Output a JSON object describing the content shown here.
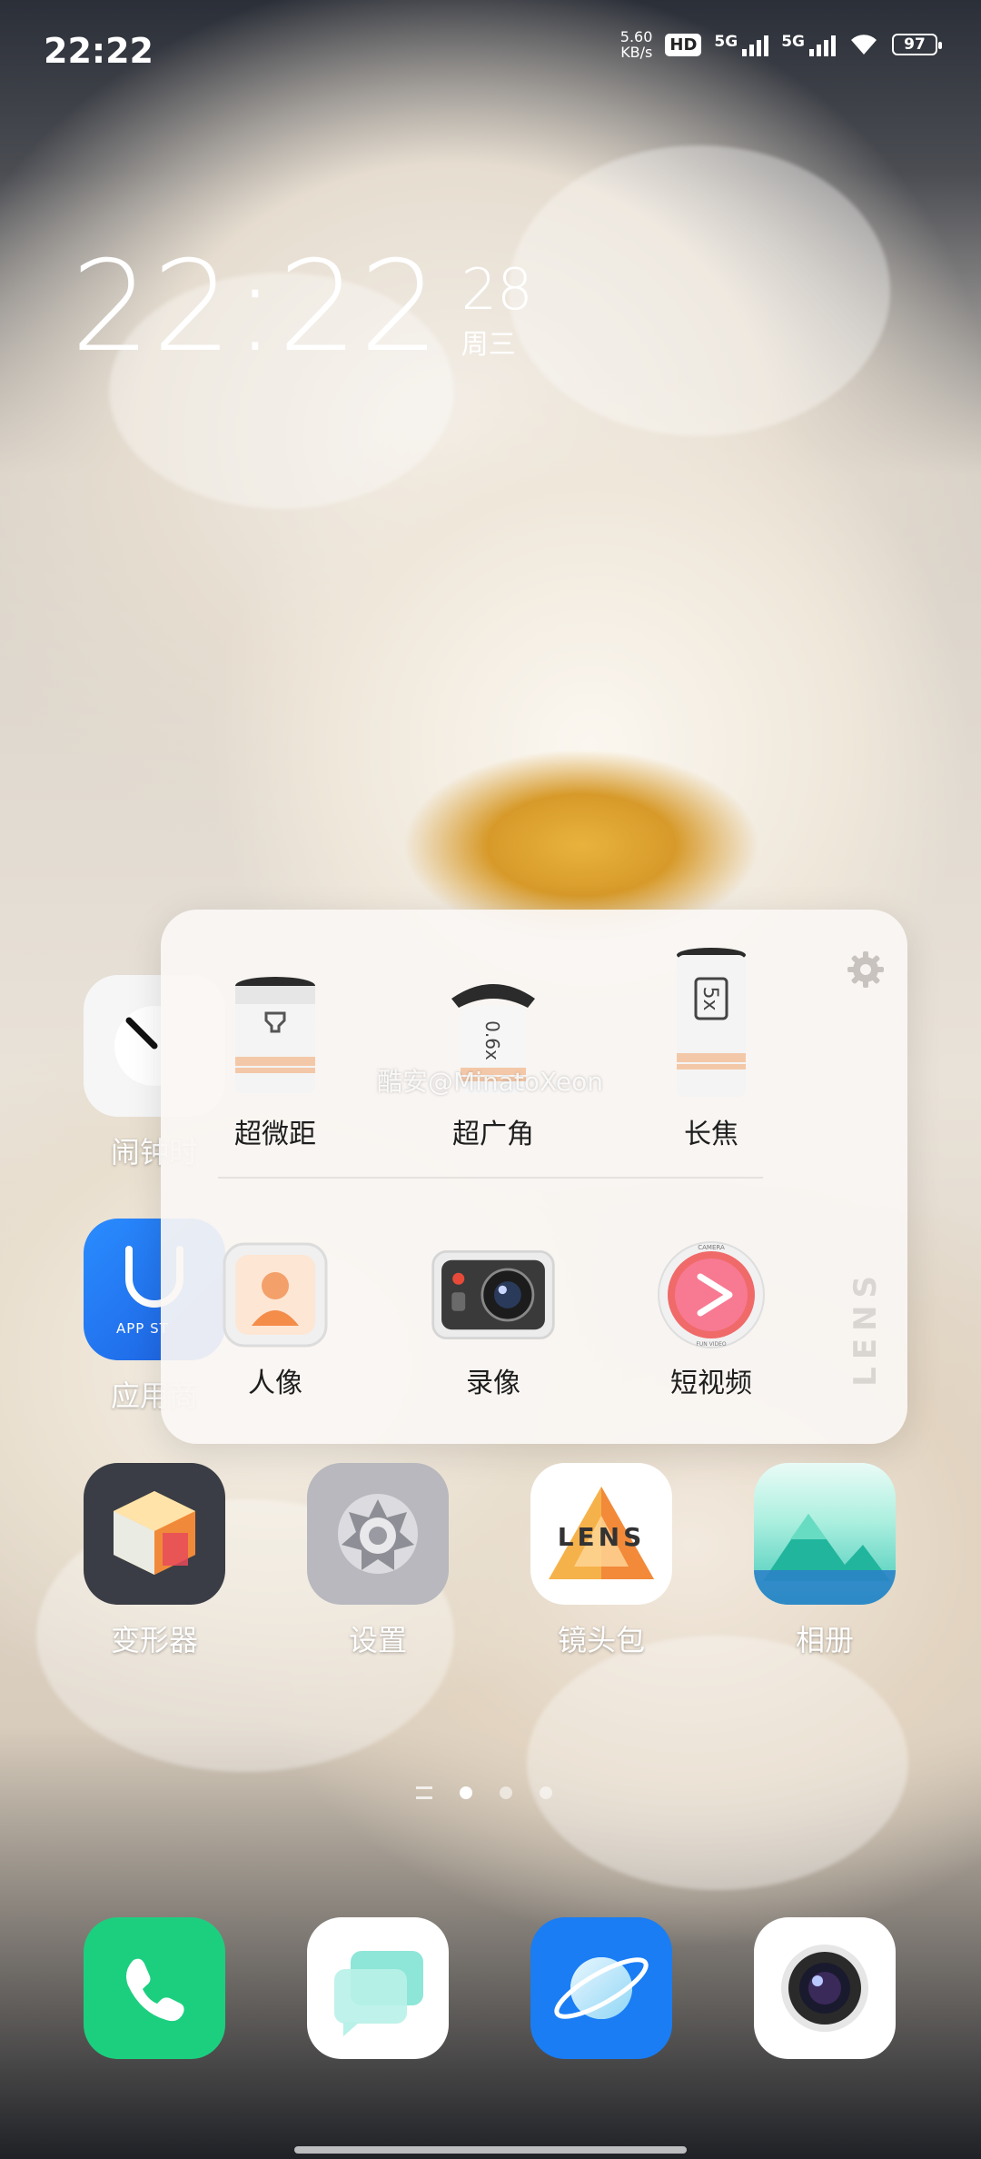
{
  "status_bar": {
    "time": "22:22",
    "net_speed_value": "5.60",
    "net_speed_unit": "KB/s",
    "hd_label": "HD",
    "sim1_label": "5G",
    "sim2_label": "5G",
    "battery": "97"
  },
  "clock_widget": {
    "time": "22:22",
    "day": "28",
    "weekday": "周三"
  },
  "home_apps": {
    "clock_label": "闹钟时",
    "appstore_label": "应用商",
    "appstore_badge": "APP ST"
  },
  "popup": {
    "watermark": "酷安@MinatoXeon",
    "lens_vertical": "LENS",
    "lenses": [
      {
        "label": "超微距",
        "icon": "macro-lens-icon"
      },
      {
        "label": "超广角",
        "icon": "wide-angle-lens-icon",
        "mark": "0.6x"
      },
      {
        "label": "长焦",
        "icon": "telephoto-lens-icon",
        "mark": "5x"
      }
    ],
    "modes": [
      {
        "label": "人像",
        "icon": "portrait-icon"
      },
      {
        "label": "录像",
        "icon": "video-recorder-icon"
      },
      {
        "label": "短视频",
        "icon": "short-video-icon",
        "ring_top": "CAMERA",
        "ring_bottom": "FUN VIDEO"
      }
    ]
  },
  "apps": [
    {
      "label": "变形器"
    },
    {
      "label": "设置"
    },
    {
      "label": "镜头包",
      "logo_text": "LENS"
    },
    {
      "label": "相册"
    }
  ],
  "dock": [
    {
      "name": "phone"
    },
    {
      "name": "messages"
    },
    {
      "name": "browser"
    },
    {
      "name": "camera"
    }
  ],
  "colors": {
    "phone": "#1ccf7f",
    "browser": "#1a7df4",
    "transformer": "#3a3d45",
    "settings": "#a9a9b0"
  }
}
